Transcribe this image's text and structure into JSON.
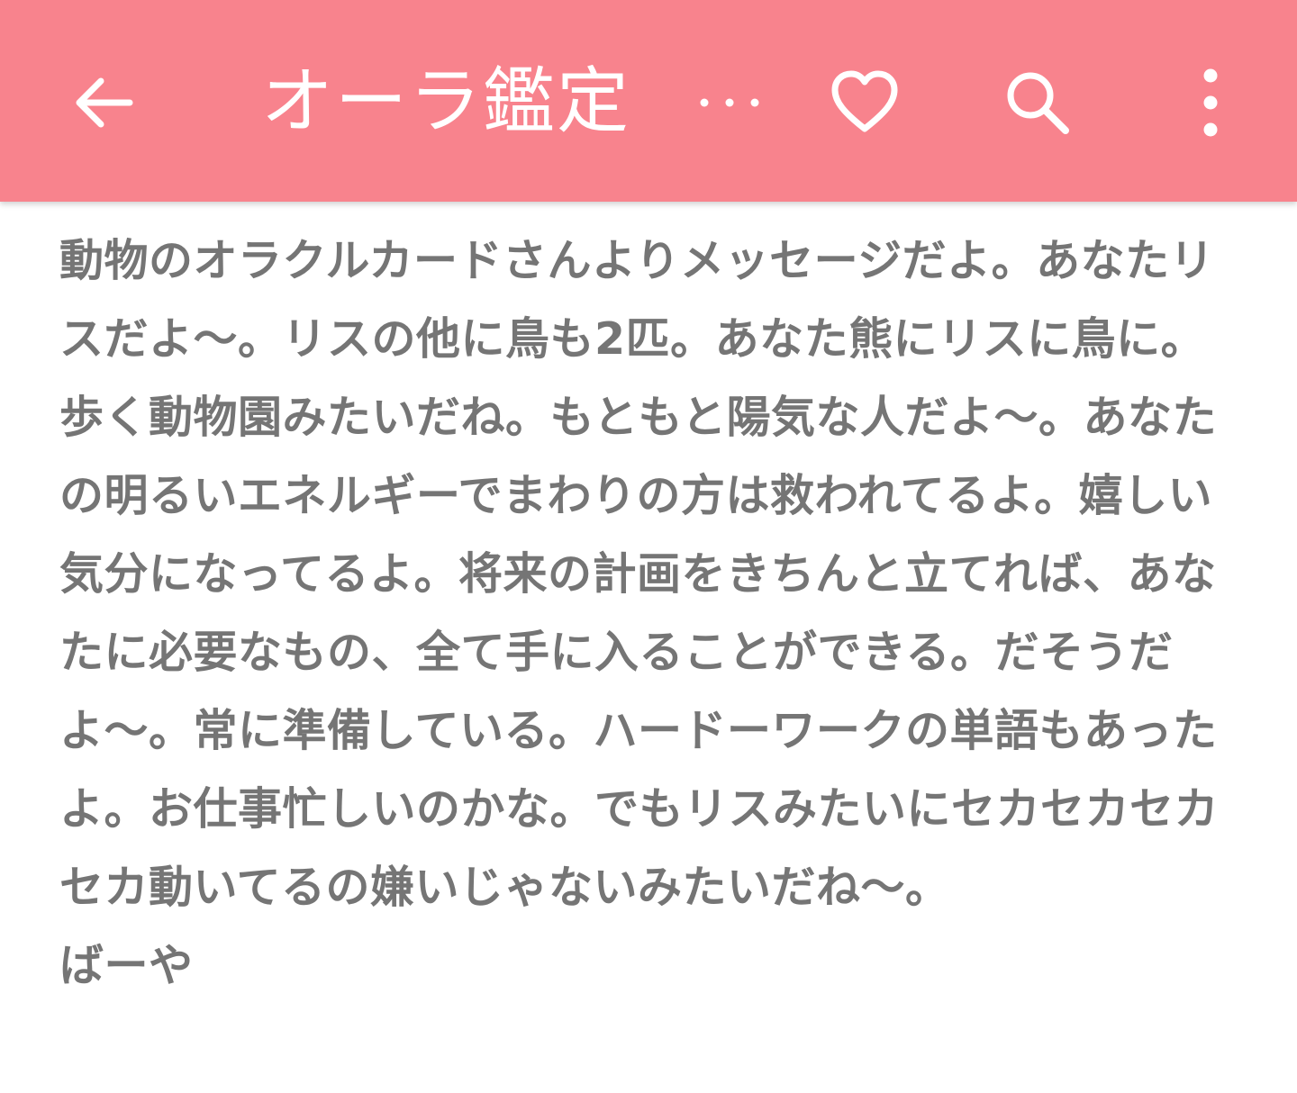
{
  "app_bar": {
    "title": "オーラ鑑定",
    "back_icon": "arrow-left-icon",
    "overflow_icon": "ellipsis-horizontal-icon",
    "favorite_icon": "heart-outline-icon",
    "search_icon": "search-icon",
    "menu_icon": "more-vertical-icon",
    "color": "#f8838d"
  },
  "content": {
    "message": "動物のオラクルカードさんよりメッセージだよ。あなたリスだよ〜。リスの他に鳥も2匹。あなた熊にリスに鳥に。歩く動物園みたいだね。もともと陽気な人だよ〜。あなたの明るいエネルギーでまわりの方は救われてるよ。嬉しい気分になってるよ。将来の計画をきちんと立てれば、あなたに必要なもの、全て手に入ることができる。だそうだよ〜。常に準備している。ハードーワークの単語もあったよ。お仕事忙しいのかな。でもリスみたいにセカセカセカセカ動いてるの嫌いじゃないみたいだね〜。",
    "signature": "ばーや",
    "text_color": "#757575"
  }
}
